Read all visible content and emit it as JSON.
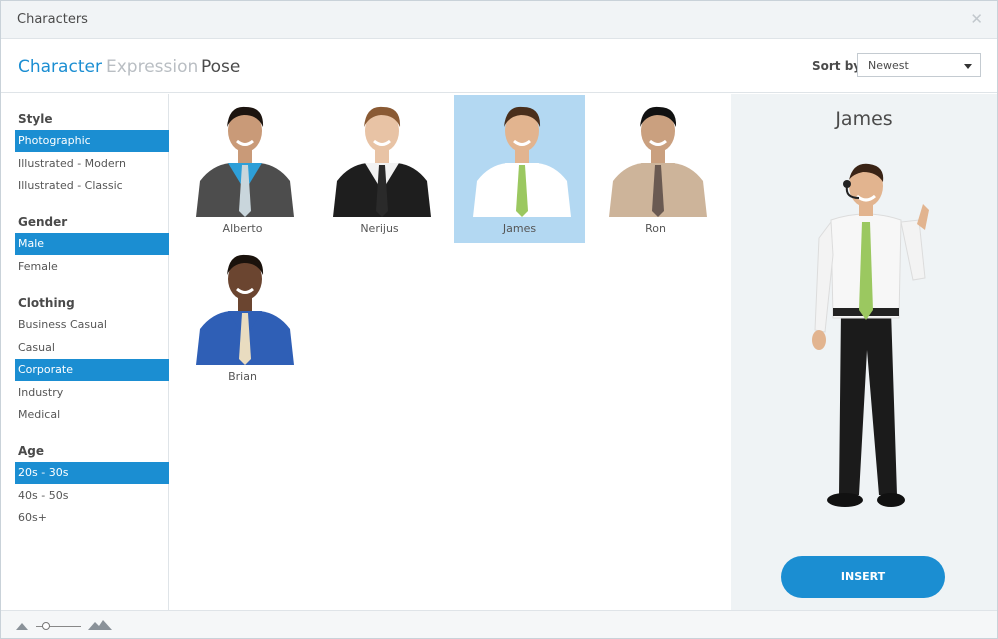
{
  "window": {
    "title": "Characters",
    "close_icon": "close-icon"
  },
  "tabs": [
    {
      "label": "Character",
      "state": "active"
    },
    {
      "label": "Expression",
      "state": "disabled"
    },
    {
      "label": "Pose",
      "state": "normal"
    }
  ],
  "sort": {
    "label": "Sort by:",
    "value": "Newest"
  },
  "sidebar": {
    "sections": [
      {
        "heading": "Style",
        "items": [
          {
            "label": "Photographic",
            "selected": true
          },
          {
            "label": "Illustrated - Modern",
            "selected": false
          },
          {
            "label": "Illustrated - Classic",
            "selected": false
          }
        ]
      },
      {
        "heading": "Gender",
        "items": [
          {
            "label": "Male",
            "selected": true
          },
          {
            "label": "Female",
            "selected": false
          }
        ]
      },
      {
        "heading": "Clothing",
        "items": [
          {
            "label": "Business Casual",
            "selected": false
          },
          {
            "label": "Casual",
            "selected": false
          },
          {
            "label": "Corporate",
            "selected": true
          },
          {
            "label": "Industry",
            "selected": false
          },
          {
            "label": "Medical",
            "selected": false
          }
        ]
      },
      {
        "heading": "Age",
        "items": [
          {
            "label": "20s - 30s",
            "selected": true
          },
          {
            "label": "40s - 50s",
            "selected": false
          },
          {
            "label": "60s+",
            "selected": false
          }
        ]
      }
    ]
  },
  "characters": [
    {
      "name": "Alberto",
      "selected": false,
      "shirt": "#2e9fd8",
      "jacket": "#4d4d4d",
      "tie": "#c9d6dc",
      "hair": "#1c140f"
    },
    {
      "name": "Nerijus",
      "selected": false,
      "shirt": "#f2f2f2",
      "jacket": "#1e1e1e",
      "tie": "#2a2a2a",
      "hair": "#8a5a34"
    },
    {
      "name": "James",
      "selected": true,
      "shirt": "#ffffff",
      "jacket": "#ffffff",
      "tie": "#9bc860",
      "hair": "#4a2f1c"
    },
    {
      "name": "Ron",
      "selected": false,
      "shirt": "#cdb49a",
      "jacket": "#cdb49a",
      "tie": "#6a5a52",
      "hair": "#111111"
    },
    {
      "name": "Brian",
      "selected": false,
      "shirt": "#2f5fb6",
      "jacket": "#2f5fb6",
      "tie": "#e9dcc0",
      "hair": "#1a120c"
    }
  ],
  "preview": {
    "name": "James",
    "insert_label": "INSERT"
  },
  "footer": {
    "zoom_small_icon": "mountain-small-icon",
    "zoom_large_icon": "mountain-large-icon"
  }
}
